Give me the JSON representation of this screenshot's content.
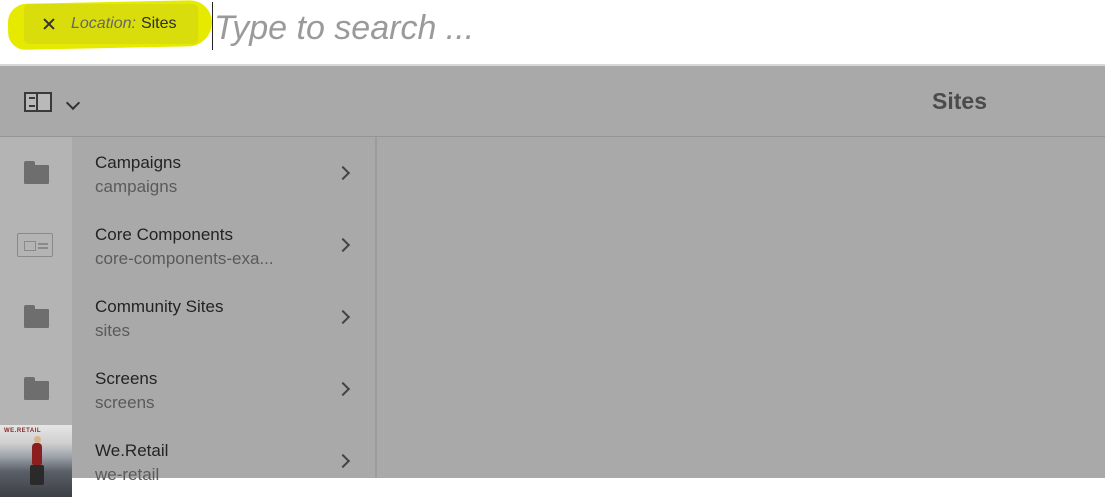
{
  "search": {
    "tag_key": "Location:",
    "tag_value": "Sites",
    "placeholder": "Type to search ..."
  },
  "header": {
    "title": "Sites"
  },
  "items": [
    {
      "title": "Campaigns",
      "name": "campaigns",
      "icon": "folder-icon"
    },
    {
      "title": "Core Components",
      "name": "core-components-exa...",
      "icon": "template-icon"
    },
    {
      "title": "Community Sites",
      "name": "sites",
      "icon": "folder-icon"
    },
    {
      "title": "Screens",
      "name": "screens",
      "icon": "folder-icon"
    },
    {
      "title": "We.Retail",
      "name": "we-retail",
      "icon": "thumbnail-image"
    }
  ],
  "colors": {
    "highlight": "#e6ea00",
    "overlay": "#a9a9a9"
  }
}
